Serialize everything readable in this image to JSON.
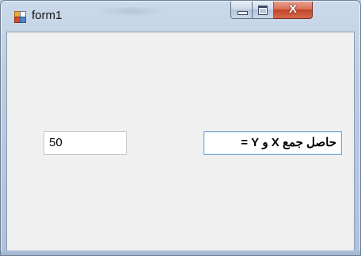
{
  "window": {
    "title": "form1",
    "icon": "windows-form-icon",
    "buttons": {
      "minimize": "minimize-icon",
      "maximize": "maximize-icon",
      "close_label": "X"
    }
  },
  "form": {
    "sum_value": "50",
    "sum_label_text": "حاصل جمع X و Y ="
  },
  "colors": {
    "frame": "#bccde1",
    "client_bg": "#f0f0f0",
    "close_button": "#c2452b"
  }
}
